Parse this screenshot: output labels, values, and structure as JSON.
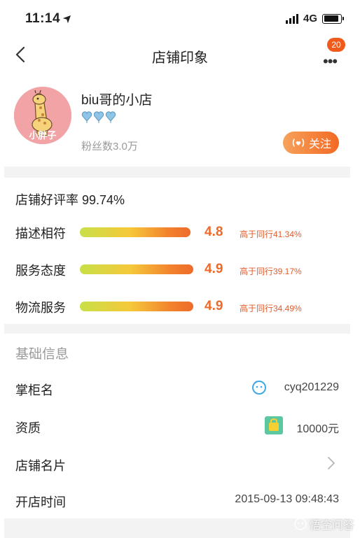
{
  "status_bar": {
    "time": "11:14",
    "network": "4G"
  },
  "nav": {
    "title": "店铺印象",
    "notification_count": "20"
  },
  "shop": {
    "name": "biu哥的小店",
    "avatar_text": "小胖子",
    "fans": "粉丝数3.0万",
    "follow_label": "关注",
    "level_badges": 3
  },
  "rating": {
    "title": "店铺好评率 99.74%",
    "items": [
      {
        "label": "描述相符",
        "score": "4.8",
        "compare": "高于同行41.34%",
        "level": 0.96
      },
      {
        "label": "服务态度",
        "score": "4.9",
        "compare": "高于同行39.17%",
        "level": 0.98
      },
      {
        "label": "物流服务",
        "score": "4.9",
        "compare": "高于同行34.49%",
        "level": 0.98
      }
    ]
  },
  "basic_info": {
    "header": "基础信息",
    "rows": [
      {
        "label": "掌柜名",
        "value": "cyq201229",
        "icon": "chat-face-icon"
      },
      {
        "label": "资质",
        "value": "10000元",
        "icon": "shopping-bag-icon"
      },
      {
        "label": "店铺名片",
        "value": "",
        "icon": "chevron-right-icon"
      },
      {
        "label": "开店时间",
        "value": "2015-09-13 09:48:43",
        "icon": ""
      }
    ]
  },
  "watermark": {
    "text": "悟空问答"
  },
  "colors": {
    "accent": "#ee6a2a",
    "background": "#f3f3f3",
    "badge": "#f05a1a"
  }
}
